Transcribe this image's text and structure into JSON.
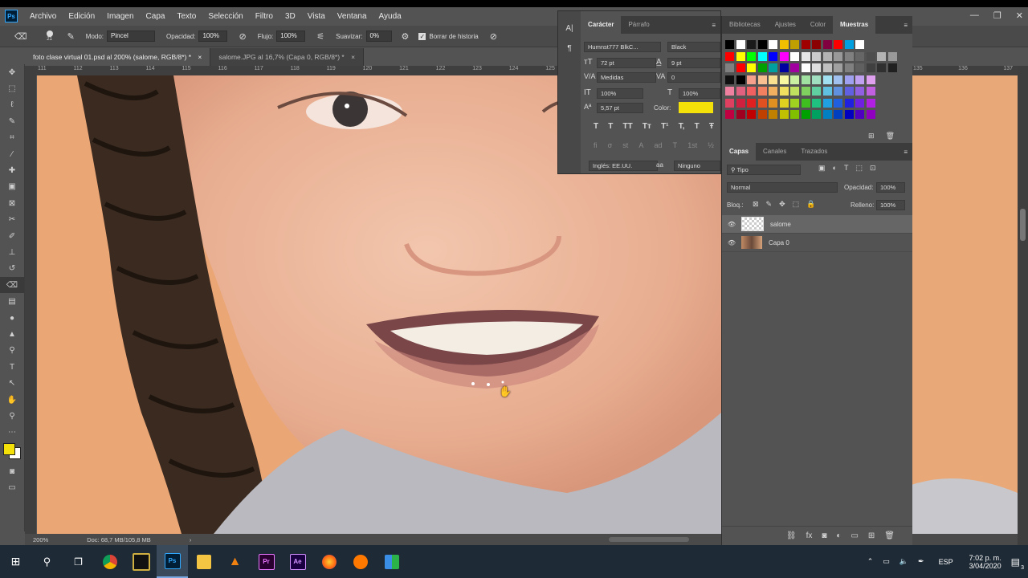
{
  "menu": {
    "items": [
      "Archivo",
      "Edición",
      "Imagen",
      "Capa",
      "Texto",
      "Selección",
      "Filtro",
      "3D",
      "Vista",
      "Ventana",
      "Ayuda"
    ],
    "logo": "Ps",
    "window_controls": [
      "minimize-icon",
      "restore-icon",
      "close-icon"
    ]
  },
  "options": {
    "brush_size": "21",
    "mode_label": "Modo:",
    "mode_value": "Pincel",
    "opacity_label": "Opacidad:",
    "opacity_value": "100%",
    "flow_label": "Flujo:",
    "flow_value": "100%",
    "smooth_label": "Suavizar:",
    "smooth_value": "0%",
    "history_label": "Borrar de historia",
    "history_checked": true
  },
  "tabs": [
    {
      "label": "foto clase virtual 01.psd al 200% (salome, RGB/8*) *",
      "active": true
    },
    {
      "label": "salome.JPG al 16,7% (Capa 0, RGB/8*) *",
      "active": false
    }
  ],
  "ruler": {
    "ticks_left": [
      "111",
      "112",
      "113",
      "114",
      "115",
      "116",
      "117",
      "118",
      "119",
      "120",
      "121",
      "122",
      "123",
      "124",
      "125"
    ],
    "ticks_right": [
      "135",
      "136",
      "137"
    ]
  },
  "status": {
    "zoom": "200%",
    "doc": "Doc: 68,7 MB/105,8 MB"
  },
  "character": {
    "tabs": [
      "Carácter",
      "Párrafo"
    ],
    "font_family": "Humnst777 BlkC...",
    "font_style": "Black",
    "font_size": "72 pt",
    "leading": "9 pt",
    "kerning": "Medidas",
    "tracking": "0",
    "vscale": "100%",
    "hscale": "100%",
    "baseline": "5,57 pt",
    "color_label": "Color:",
    "color": "#f5e10a",
    "style_buttons": [
      "T",
      "T",
      "TT",
      "Tт",
      "T¹",
      "T,",
      "T",
      "Ŧ"
    ],
    "ot_buttons": [
      "fi",
      "σ",
      "st",
      "A",
      "ad",
      "T",
      "1st",
      "½"
    ],
    "language": "Inglés: EE.UU.",
    "aa_label": "aa",
    "antialias": "Ninguno"
  },
  "swatches_panel": {
    "tabs": [
      "Bibliotecas",
      "Ajustes",
      "Color",
      "Muestras"
    ],
    "rows": [
      [
        "#000000",
        "#ffffff",
        "#1a1a1a",
        "#000000",
        "#ffffff",
        "#f0c000",
        "#c0a000",
        "#a00000",
        "#8b0000",
        "#800040",
        "#ff0000",
        "#00a0e0",
        "#ffffff"
      ],
      [
        "#ff0000",
        "#ffff00",
        "#00ff00",
        "#00ffff",
        "#0000ff",
        "#ff00ff",
        "#ffffff",
        "#e6e6e6",
        "#cccccc",
        "#b3b3b3",
        "#999999",
        "#808080",
        "#666666",
        "#4d4d4d",
        "#b3b3b3",
        "#999999"
      ],
      [
        "#808080",
        "#ff0000",
        "#ffff00",
        "#00a000",
        "#00a0a0",
        "#0000a0",
        "#a000a0",
        "#ffffff",
        "#e0e0e0",
        "#c0c0c0",
        "#a0a0a0",
        "#808080",
        "#606060",
        "#404040",
        "#303030",
        "#202020"
      ],
      [
        "#101010",
        "#000000",
        "#f4a08c",
        "#f8c090",
        "#f8e090",
        "#f8f8a0",
        "#c8f0a0",
        "#a0e0a0",
        "#a0e0c0",
        "#a0e0f0",
        "#a0c0f0",
        "#a0a0f0",
        "#c0a0f0",
        "#e0a0f0"
      ],
      [
        "#f080a0",
        "#e06080",
        "#f06060",
        "#f08060",
        "#f0b060",
        "#f0e060",
        "#c0e060",
        "#80d060",
        "#60d0a0",
        "#60c0e0",
        "#6090e0",
        "#6060e0",
        "#9060e0",
        "#c060e0"
      ],
      [
        "#e04060",
        "#d02040",
        "#e02020",
        "#e05020",
        "#e09020",
        "#e0d020",
        "#a0d020",
        "#40c020",
        "#20c080",
        "#20a0e0",
        "#2060e0",
        "#2020e0",
        "#7020e0",
        "#b020e0"
      ],
      [
        "#c00040",
        "#a00020",
        "#c00000",
        "#c04000",
        "#c08000",
        "#c0c000",
        "#80c000",
        "#00a000",
        "#00a060",
        "#0080c0",
        "#0040c0",
        "#0000c0",
        "#5000c0",
        "#9000c0"
      ]
    ]
  },
  "layers_panel": {
    "tabs": [
      "Capas",
      "Canales",
      "Trazados"
    ],
    "filter": "Tipo",
    "blend_mode": "Normal",
    "opacity_label": "Opacidad:",
    "opacity": "100%",
    "lock_label": "Bloq.:",
    "fill_label": "Relleno:",
    "fill": "100%",
    "layers": [
      {
        "name": "salome",
        "selected": true
      },
      {
        "name": "Capa 0",
        "selected": false
      }
    ]
  },
  "taskbar": {
    "apps": [
      "windows-start",
      "search",
      "task-view",
      "chrome",
      "unknown-app",
      "photoshop",
      "file-explorer",
      "vlc",
      "premiere",
      "after-effects",
      "firefox",
      "avast",
      "tiles"
    ],
    "lang": "ESP",
    "time": "7:02 p. m.",
    "date": "3/04/2020",
    "notif_count": "3"
  }
}
